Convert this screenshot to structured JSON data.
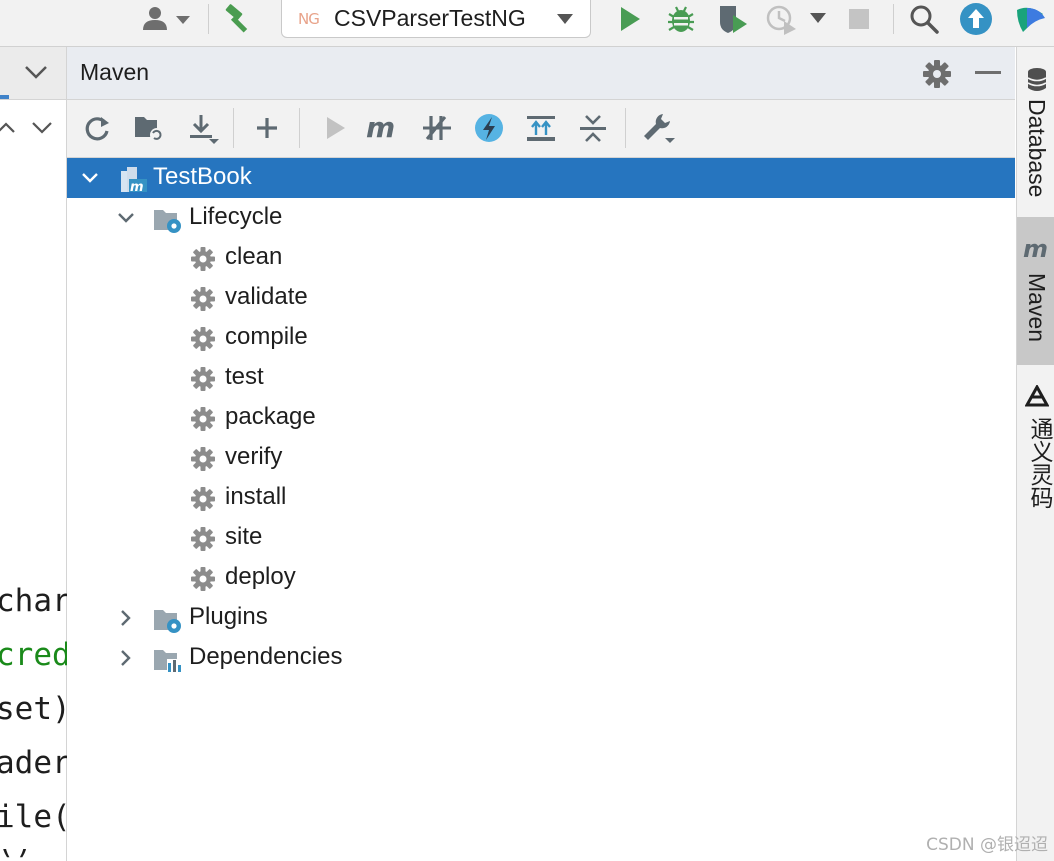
{
  "toolbar": {
    "run_config": {
      "prefix": "NG",
      "name": "CSVParserTestNG"
    },
    "icons": [
      "user-icon",
      "build-hammer-icon",
      "run-icon",
      "debug-icon",
      "coverage-icon",
      "profile-icon",
      "stop-icon",
      "search-icon",
      "update-icon",
      "plugin-logo-icon"
    ]
  },
  "editor": {
    "lines": [
      {
        "text": "char",
        "color": "#1e1e1e"
      },
      {
        "text": "cred",
        "color": "#1a8a1a"
      },
      {
        "text": "set)",
        "color": "#1e1e1e"
      },
      {
        "text": "ader",
        "color": "#1e1e1e"
      },
      {
        "text": "ile(",
        "color": "#1e1e1e"
      },
      {
        "text": "()",
        "color": "#1e1e1e"
      }
    ]
  },
  "maven": {
    "title": "Maven",
    "toolbar_icons": [
      "reload-icon",
      "generate-sources-icon",
      "download-icon",
      "add-icon",
      "run-maven-icon",
      "execute-goal-icon",
      "toggle-offline-icon",
      "skip-tests-icon",
      "show-dependencies-icon",
      "collapse-all-icon",
      "settings-wrench-icon"
    ],
    "tree": {
      "project": "TestBook",
      "lifecycle_label": "Lifecycle",
      "phases": [
        "clean",
        "validate",
        "compile",
        "test",
        "package",
        "verify",
        "install",
        "site",
        "deploy"
      ],
      "plugins_label": "Plugins",
      "dependencies_label": "Dependencies"
    }
  },
  "sidebar": {
    "tabs": [
      {
        "label": "Database"
      },
      {
        "label": "Maven"
      },
      {
        "label": "通义灵码"
      }
    ]
  },
  "watermark": "CSDN @银迢迢",
  "colors": {
    "selection": "#2675bf",
    "accent_blue": "#3592c4",
    "run_green": "#499c54",
    "gear_gray": "#8c8c8c"
  }
}
